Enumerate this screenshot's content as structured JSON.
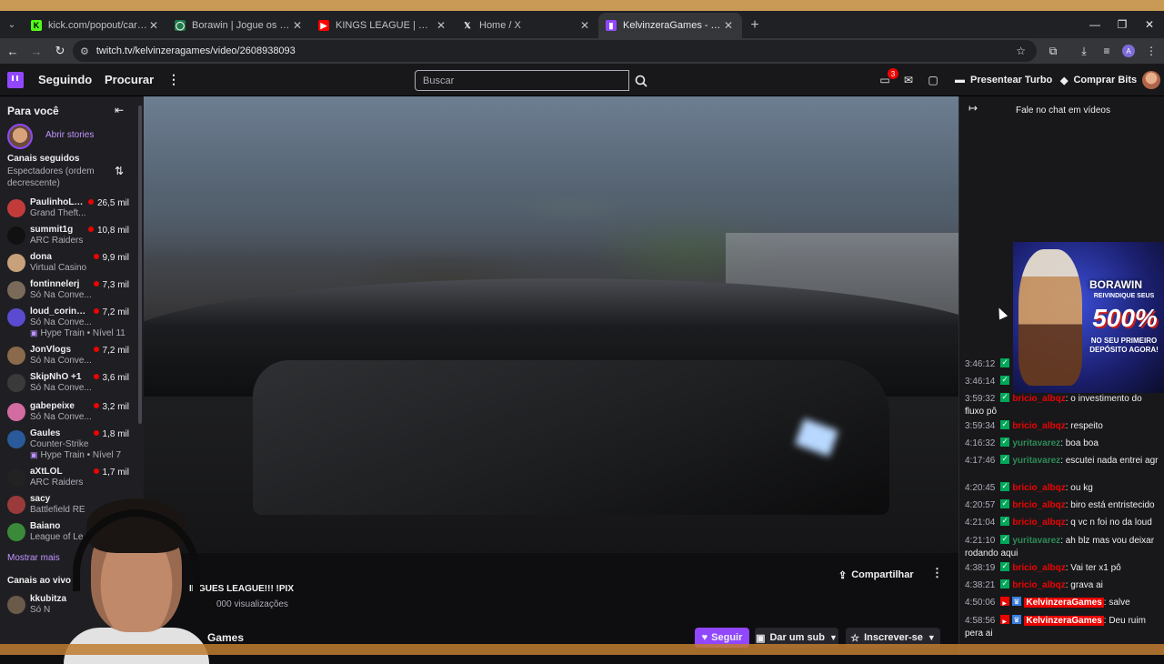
{
  "browser": {
    "tabs": [
      {
        "title": "kick.com/popout/carioca/chat",
        "fav_color": "#53fc18",
        "fav_char": "K"
      },
      {
        "title": "Borawin | Jogue os Melhores Sl",
        "fav_color": "#1f7a4a",
        "fav_char": "◯"
      },
      {
        "title": "KINGS LEAGUE | ÚLTIMA RO",
        "fav_color": "#ff0000",
        "fav_char": "▶"
      },
      {
        "title": "Home / X",
        "fav_color": "#202124",
        "fav_char": "𝕏"
      },
      {
        "title": "KelvinzeraGames - Twitch",
        "fav_color": "#9147ff",
        "fav_char": "▮"
      }
    ],
    "url": "twitch.tv/kelvinzeragames/video/2608938093",
    "profile_initial": "A"
  },
  "nav": {
    "following": "Seguindo",
    "browse": "Procurar",
    "search_placeholder": "Buscar",
    "notification_count": "3",
    "turbo": "Presentear Turbo",
    "bits": "Comprar Bits"
  },
  "sidebar": {
    "for_you": "Para você",
    "open_stories": "Abrir stories",
    "followed_title": "Canais seguidos",
    "followed_sort": "Espectadores (ordem decrescente)",
    "channels": [
      {
        "name": "PaulinhoLO...",
        "game": "Grand Theft...",
        "viewers": "26,5 mil",
        "color": "#c23b3b",
        "hype": ""
      },
      {
        "name": "summit1g",
        "game": "ARC Raiders",
        "viewers": "10,8 mil",
        "color": "#111111",
        "hype": ""
      },
      {
        "name": "dona",
        "game": "Virtual Casino",
        "viewers": "9,9 mil",
        "color": "#c8a07a",
        "hype": ""
      },
      {
        "name": "fontinnelerj",
        "game": "Só Na Conve...",
        "viewers": "7,3 mil",
        "color": "#7a6a5a",
        "hype": ""
      },
      {
        "name": "loud_coringa",
        "game": "Só Na Conve...",
        "viewers": "7,2 mil",
        "color": "#5a4bd0",
        "hype": "Hype Train • Nível 11"
      },
      {
        "name": "JonVlogs",
        "game": "Só Na Conve...",
        "viewers": "7,2 mil",
        "color": "#8a6a4a",
        "hype": ""
      },
      {
        "name": "SkipNhO +1",
        "game": "Só Na Conve...",
        "viewers": "3,6 mil",
        "color": "#3a3a3a",
        "hype": ""
      },
      {
        "name": "gabepeixe",
        "game": "Só Na Conve...",
        "viewers": "3,2 mil",
        "color": "#d26ca0",
        "hype": ""
      },
      {
        "name": "Gaules",
        "game": "Counter-Strike",
        "viewers": "1,8 mil",
        "color": "#2a5a9a",
        "hype": "Hype Train • Nível 7"
      },
      {
        "name": "aXtLOL",
        "game": "ARC Raiders",
        "viewers": "1,7 mil",
        "color": "#222222",
        "hype": ""
      },
      {
        "name": "sacy",
        "game": "Battlefield RE",
        "viewers": "",
        "color": "#9a3a3a",
        "hype": ""
      },
      {
        "name": "Baiano",
        "game": "League of Le",
        "viewers": "",
        "color": "#3a8a3a",
        "hype": ""
      }
    ],
    "show_more": "Mostrar mais",
    "live_title": "Canais ao vivo",
    "live_channels": [
      {
        "name": "kkubitza",
        "game": "Só N",
        "color": "#6a5a4a"
      }
    ]
  },
  "video": {
    "title": "INGUES LEAGUE!!! !PIX",
    "views": "000 visualizações",
    "channel": "Games",
    "share": "Compartilhar",
    "follow": "Seguir",
    "gift_sub": "Dar um sub",
    "subscribe": "Inscrever-se"
  },
  "chat": {
    "title": "Fale no chat em vídeos",
    "messages": [
      {
        "ts": "3:46:12",
        "user": "",
        "color": "#eb0400",
        "text": "",
        "badge": "sub"
      },
      {
        "ts": "3:46:14",
        "user": "",
        "color": "#eb0400",
        "text": "",
        "badge": "sub"
      },
      {
        "ts": "3:59:32",
        "user": "bricio_albqz",
        "color": "#eb0400",
        "text": "o investimento do fluxo pô",
        "badge": "sub"
      },
      {
        "ts": "3:59:34",
        "user": "bricio_albqz",
        "color": "#eb0400",
        "text": "respeito",
        "badge": "sub"
      },
      {
        "ts": "4:16:32",
        "user": "yuritavarez",
        "color": "#2e8b57",
        "text": "boa boa",
        "badge": "sub"
      },
      {
        "ts": "4:17:46",
        "user": "yuritavarez",
        "color": "#2e8b57",
        "text": "escutei nada entrei agr",
        "badge": "sub"
      },
      {
        "ts": "4:20:45",
        "user": "bricio_albqz",
        "color": "#eb0400",
        "text": "ou kg",
        "badge": "sub"
      },
      {
        "ts": "4:20:57",
        "user": "bricio_albqz",
        "color": "#eb0400",
        "text": "biro está entristecido",
        "badge": "sub"
      },
      {
        "ts": "4:21:04",
        "user": "bricio_albqz",
        "color": "#eb0400",
        "text": "q vc n foi no da loud",
        "badge": "sub"
      },
      {
        "ts": "4:21:10",
        "user": "yuritavarez",
        "color": "#2e8b57",
        "text": "ah blz mas vou deixar rodando aqui",
        "badge": "sub"
      },
      {
        "ts": "4:38:19",
        "user": "bricio_albqz",
        "color": "#eb0400",
        "text": "Vai ter x1 pô",
        "badge": "sub"
      },
      {
        "ts": "4:38:21",
        "user": "bricio_albqz",
        "color": "#eb0400",
        "text": "grava ai",
        "badge": "sub"
      },
      {
        "ts": "4:50:06",
        "user": "KelvinzeraGames",
        "color": "#ff4a4a",
        "text": "salve",
        "badge": "broadcaster"
      },
      {
        "ts": "4:58:56",
        "user": "KelvinzeraGames",
        "color": "#ff4a4a",
        "text": "Deu ruim pera ai",
        "badge": "broadcaster"
      }
    ]
  },
  "ad": {
    "brand": "BORAWIN",
    "claim": "REIVINDIQUE SEUS",
    "percent": "500%",
    "sub": "NO SEU PRIMEIRO DEPÓSITO AGORA!"
  },
  "colors": {
    "accent": "#9147ff",
    "live": "#eb0400",
    "bg": "#0e0e10"
  }
}
